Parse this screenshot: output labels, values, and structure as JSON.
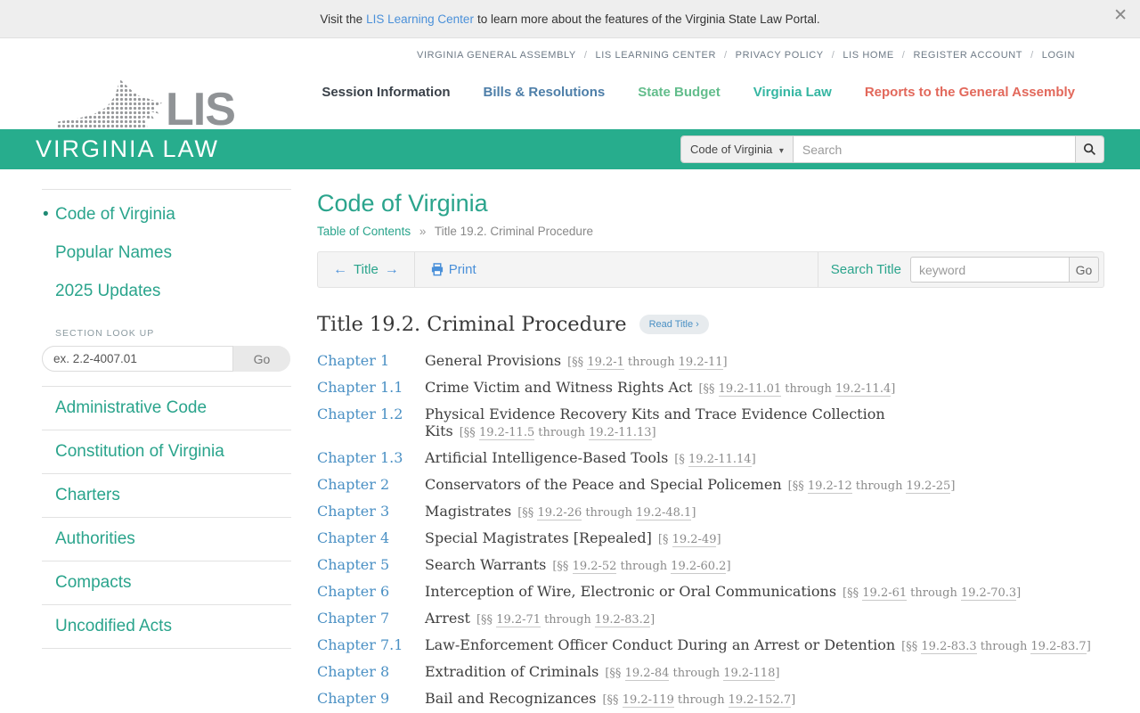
{
  "banner": {
    "prefix": "Visit the",
    "link_label": "LIS Learning Center",
    "suffix": "to learn more about the features of the Virginia State Law Portal.",
    "close_glyph": "✕"
  },
  "utility_nav": {
    "items": [
      {
        "label": "VIRGINIA GENERAL ASSEMBLY"
      },
      {
        "label": "LIS LEARNING CENTER"
      },
      {
        "label": "PRIVACY POLICY"
      },
      {
        "label": "LIS HOME"
      },
      {
        "label": "REGISTER ACCOUNT"
      },
      {
        "label": "LOGIN"
      }
    ]
  },
  "logo": {
    "text": "LIS"
  },
  "main_nav": {
    "items": [
      {
        "label": "Session Information",
        "color": "#3a4149"
      },
      {
        "label": "Bills & Resolutions",
        "color": "#4d7ea8"
      },
      {
        "label": "State Budget",
        "color": "#63bd8c"
      },
      {
        "label": "Virginia Law",
        "color": "#35b6a2"
      },
      {
        "label": "Reports to the General Assembly",
        "color": "#e2685b"
      }
    ]
  },
  "green_bar": {
    "title": "VIRGINIA LAW",
    "accent_color": "#27ad8d",
    "search": {
      "filter_label": "Code of Virginia",
      "caret": "▾",
      "placeholder": "Search"
    }
  },
  "sidebar": {
    "bullet": "•",
    "primary_items": [
      {
        "label": "Code of Virginia",
        "active": true
      },
      {
        "label": "Popular Names"
      },
      {
        "label": "2025 Updates"
      }
    ],
    "section_lookup": {
      "label": "SECTION LOOK UP",
      "placeholder": "ex. 2.2-4007.01",
      "go_label": "Go"
    },
    "secondary_items": [
      {
        "label": "Administrative Code"
      },
      {
        "label": "Constitution of Virginia"
      },
      {
        "label": "Charters"
      },
      {
        "label": "Authorities"
      },
      {
        "label": "Compacts"
      },
      {
        "label": "Uncodified Acts"
      }
    ]
  },
  "main": {
    "page_title": "Code of Virginia",
    "breadcrumb": {
      "link": "Table of Contents",
      "separator": "»",
      "current": "Title 19.2. Criminal Procedure"
    },
    "toolbar": {
      "prev_arrow": "←",
      "title_label": "Title",
      "next_arrow": "→",
      "print_label": "Print",
      "search_label": "Search Title",
      "keyword_placeholder": "keyword",
      "go_label": "Go"
    },
    "heading": "Title 19.2. Criminal Procedure",
    "read_title_label": "Read Title ›",
    "chapters": [
      {
        "num": "Chapter 1",
        "name": "General Provisions",
        "ref": {
          "prefix": "[§§",
          "from": "19.2-1",
          "mid": "through",
          "to": "19.2-11",
          "suffix": "]"
        }
      },
      {
        "num": "Chapter 1.1",
        "name": "Crime Victim and Witness Rights Act",
        "ref": {
          "prefix": "[§§",
          "from": "19.2-11.01",
          "mid": "through",
          "to": "19.2-11.4",
          "suffix": "]"
        }
      },
      {
        "num": "Chapter 1.2",
        "name": "Physical Evidence Recovery Kits and Trace Evidence Collection Kits",
        "ref": {
          "prefix": "[§§",
          "from": "19.2-11.5",
          "mid": "through",
          "to": "19.2-11.13",
          "suffix": "]"
        }
      },
      {
        "num": "Chapter 1.3",
        "name": "Artificial Intelligence-Based Tools",
        "ref": {
          "prefix": "[§",
          "from": "19.2-11.14",
          "mid": "",
          "to": "",
          "suffix": "]"
        }
      },
      {
        "num": "Chapter 2",
        "name": "Conservators of the Peace and Special Policemen",
        "ref": {
          "prefix": "[§§",
          "from": "19.2-12",
          "mid": "through",
          "to": "19.2-25",
          "suffix": "]"
        }
      },
      {
        "num": "Chapter 3",
        "name": "Magistrates",
        "ref": {
          "prefix": "[§§",
          "from": "19.2-26",
          "mid": "through",
          "to": "19.2-48.1",
          "suffix": "]"
        }
      },
      {
        "num": "Chapter 4",
        "name": "Special Magistrates [Repealed]",
        "ref": {
          "prefix": "[§",
          "from": "19.2-49",
          "mid": "",
          "to": "",
          "suffix": "]"
        }
      },
      {
        "num": "Chapter 5",
        "name": "Search Warrants",
        "ref": {
          "prefix": "[§§",
          "from": "19.2-52",
          "mid": "through",
          "to": "19.2-60.2",
          "suffix": "]"
        }
      },
      {
        "num": "Chapter 6",
        "name": "Interception of Wire, Electronic or Oral Communications",
        "ref": {
          "prefix": "[§§",
          "from": "19.2-61",
          "mid": "through",
          "to": "19.2-70.3",
          "suffix": "]"
        }
      },
      {
        "num": "Chapter 7",
        "name": "Arrest",
        "ref": {
          "prefix": "[§§",
          "from": "19.2-71",
          "mid": "through",
          "to": "19.2-83.2",
          "suffix": "]"
        }
      },
      {
        "num": "Chapter 7.1",
        "name": "Law-Enforcement Officer Conduct During an Arrest or Detention",
        "ref": {
          "prefix": "[§§",
          "from": "19.2-83.3",
          "mid": "through",
          "to": "19.2-83.7",
          "suffix": "]"
        }
      },
      {
        "num": "Chapter 8",
        "name": "Extradition of Criminals",
        "ref": {
          "prefix": "[§§",
          "from": "19.2-84",
          "mid": "through",
          "to": "19.2-118",
          "suffix": "]"
        }
      },
      {
        "num": "Chapter 9",
        "name": "Bail and Recognizances",
        "ref": {
          "prefix": "[§§",
          "from": "19.2-119",
          "mid": "through",
          "to": "19.2-152.7",
          "suffix": "]"
        }
      }
    ]
  }
}
